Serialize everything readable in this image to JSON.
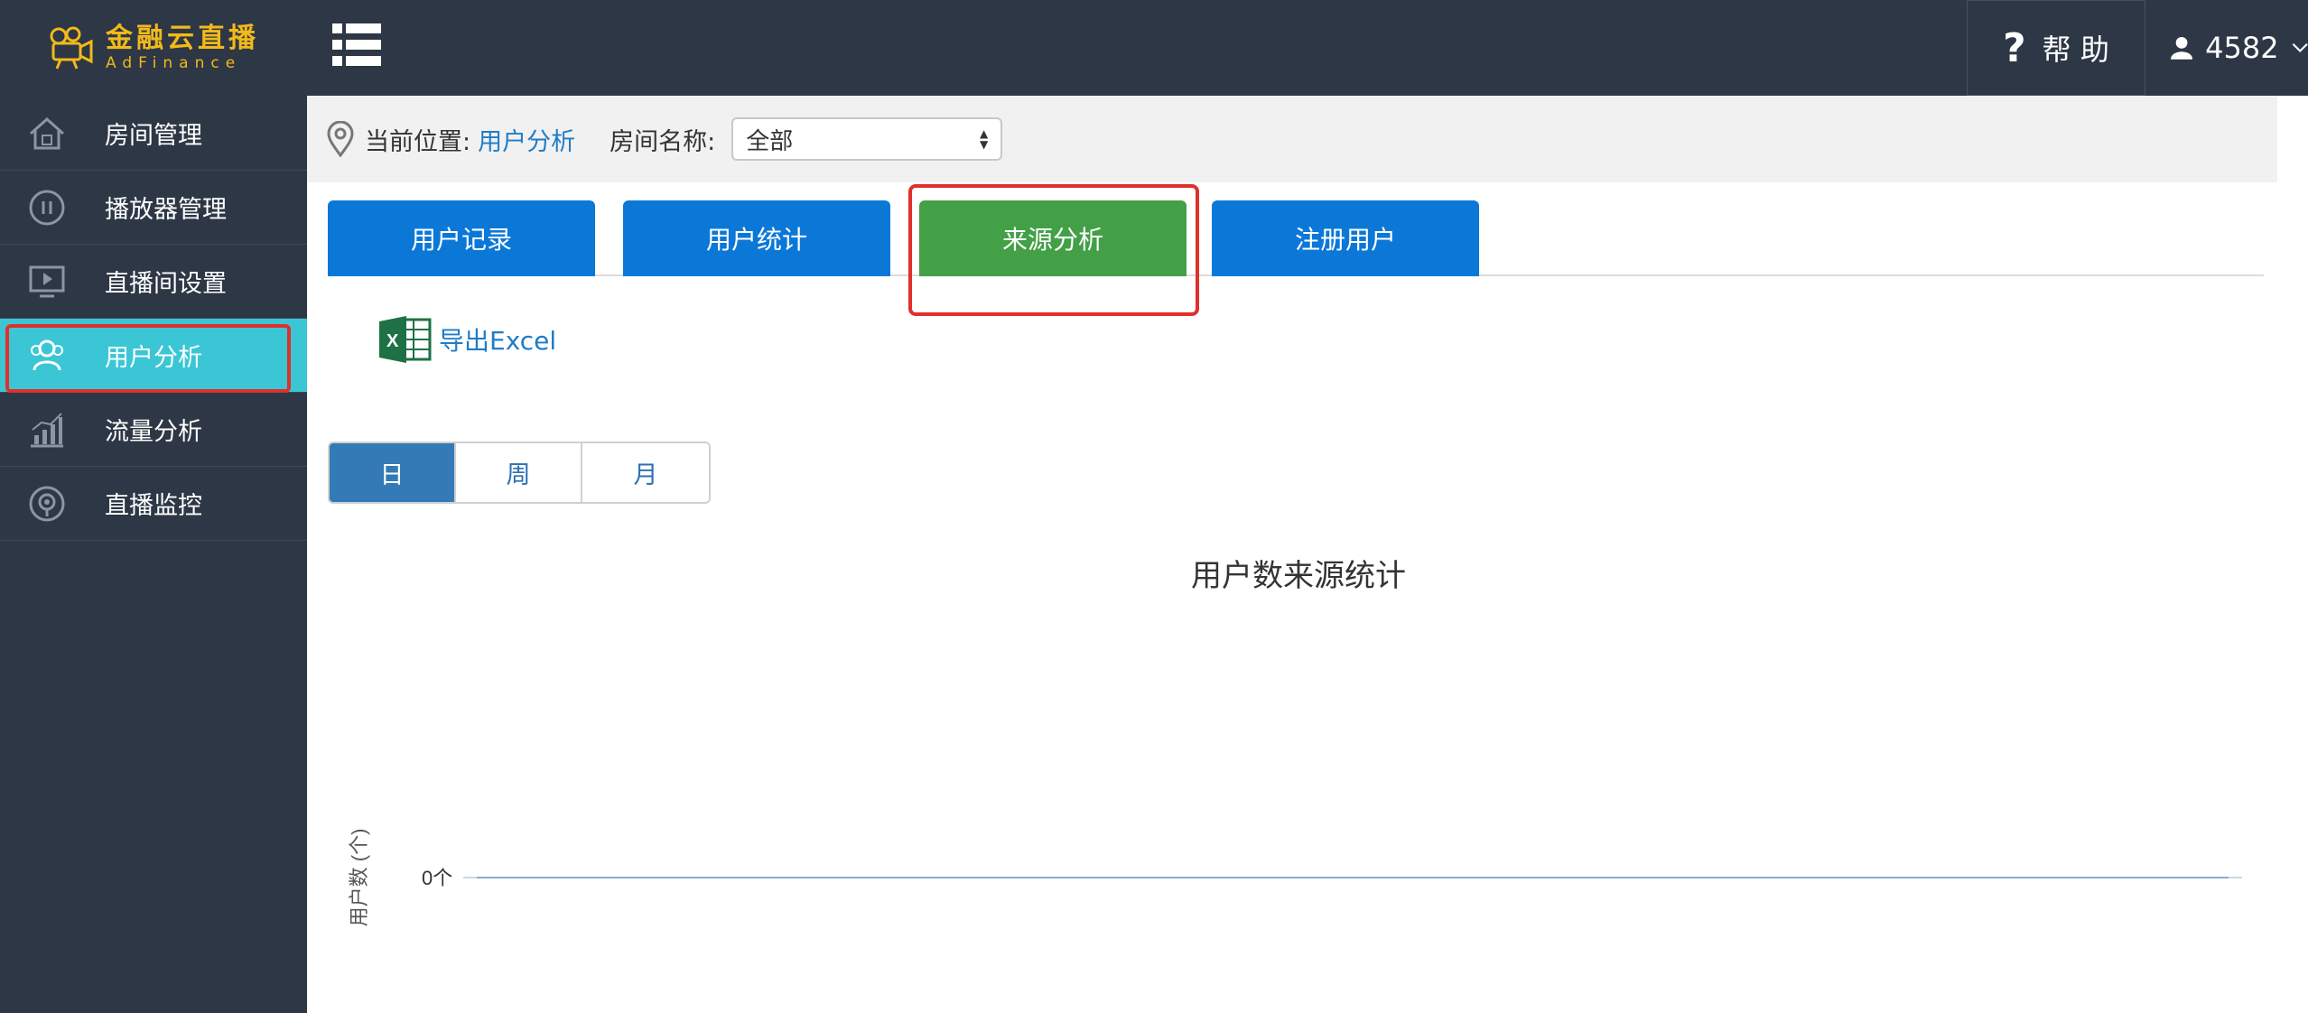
{
  "logo": {
    "cn": "金融云直播",
    "en": "AdFinance"
  },
  "sidebar": {
    "items": [
      {
        "label": "房间管理",
        "icon": "home-icon",
        "active": false
      },
      {
        "label": "播放器管理",
        "icon": "pause-circle-icon",
        "active": false
      },
      {
        "label": "直播间设置",
        "icon": "monitor-play-icon",
        "active": false
      },
      {
        "label": "用户分析",
        "icon": "users-icon",
        "active": true
      },
      {
        "label": "流量分析",
        "icon": "bar-chart-icon",
        "active": false
      },
      {
        "label": "直播监控",
        "icon": "monitor-target-icon",
        "active": false
      }
    ]
  },
  "topbar": {
    "menu_icon": "list-menu-icon",
    "help_label": "帮 助",
    "help_icon": "question-icon",
    "user_name": "4582",
    "user_icon": "user-icon",
    "dropdown_icon": "chevron-down-icon"
  },
  "breadcrumb": {
    "prefix": "当前位置:",
    "current": "用户分析",
    "room_label": "房间名称:",
    "room_value": "全部"
  },
  "tabs": [
    {
      "label": "用户记录",
      "active": false
    },
    {
      "label": "用户统计",
      "active": false
    },
    {
      "label": "来源分析",
      "active": true
    },
    {
      "label": "注册用户",
      "active": false
    }
  ],
  "export": {
    "label": "导出Excel",
    "icon": "excel-icon"
  },
  "period": [
    {
      "label": "日",
      "active": true
    },
    {
      "label": "周",
      "active": false
    },
    {
      "label": "月",
      "active": false
    }
  ],
  "colors": {
    "sidebar_bg": "#2d3745",
    "active_nav": "#3bc6d6",
    "tab_blue": "#0b78d8",
    "tab_green": "#43a047",
    "highlight_red": "#e0302b",
    "logo_gold": "#f2b91a",
    "link_blue": "#1f7cc7"
  },
  "chart_data": {
    "type": "line",
    "title": "用户数来源统计",
    "ylabel": "用户数 (个)",
    "y_ticks": [
      "0个"
    ],
    "series": [
      {
        "values": [
          0,
          0
        ]
      }
    ],
    "grid": false
  }
}
